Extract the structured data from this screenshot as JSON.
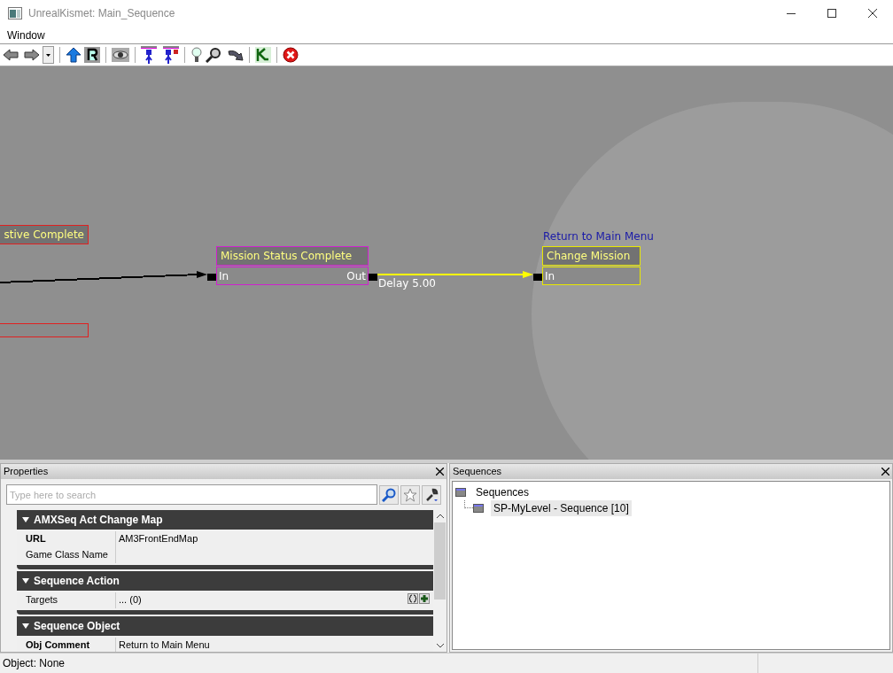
{
  "window": {
    "title": "UnrealKismet: Main_Sequence"
  },
  "menu": [
    "Window"
  ],
  "canvas": {
    "nodes": [
      {
        "title": "stive Complete",
        "color": "#e02020"
      },
      {
        "title": "Mission Status Complete",
        "color": "#d020d0",
        "inputs": [
          "In"
        ],
        "outputs": [
          "Out"
        ]
      },
      {
        "title": "Change Mission",
        "color": "#e8e800",
        "inputs": [
          "In"
        ],
        "comment": "Return to Main Menu"
      }
    ],
    "links": [
      {
        "color": "#000000"
      },
      {
        "color": "#ffff00",
        "label": "Delay 5.00"
      }
    ]
  },
  "properties": {
    "title": "Properties",
    "search": {
      "placeholder": "Type here to search"
    },
    "sections": [
      {
        "title": "AMXSeq Act Change Map",
        "expanded": true,
        "rows": [
          {
            "name": "URL",
            "value": "AM3FrontEndMap",
            "bold": true
          },
          {
            "name": "Game Class Name",
            "value": "",
            "bold": false
          }
        ]
      },
      {
        "title": "Sequence Action",
        "expanded": true,
        "rows": [
          {
            "name": "Targets",
            "value": "... (0)",
            "bold": false,
            "kind": "array"
          }
        ]
      },
      {
        "title": "Sequence Object",
        "expanded": true,
        "rows": [
          {
            "name": "Obj Comment",
            "value": "Return to Main Menu",
            "bold": true
          }
        ]
      }
    ]
  },
  "sequences": {
    "title": "Sequences",
    "tree": [
      {
        "label": "Sequences",
        "selected": false,
        "children": [
          {
            "label": "SP-MyLevel - Sequence [10]",
            "selected": true
          }
        ]
      }
    ]
  },
  "status_bar": {
    "text": "Object: None"
  }
}
